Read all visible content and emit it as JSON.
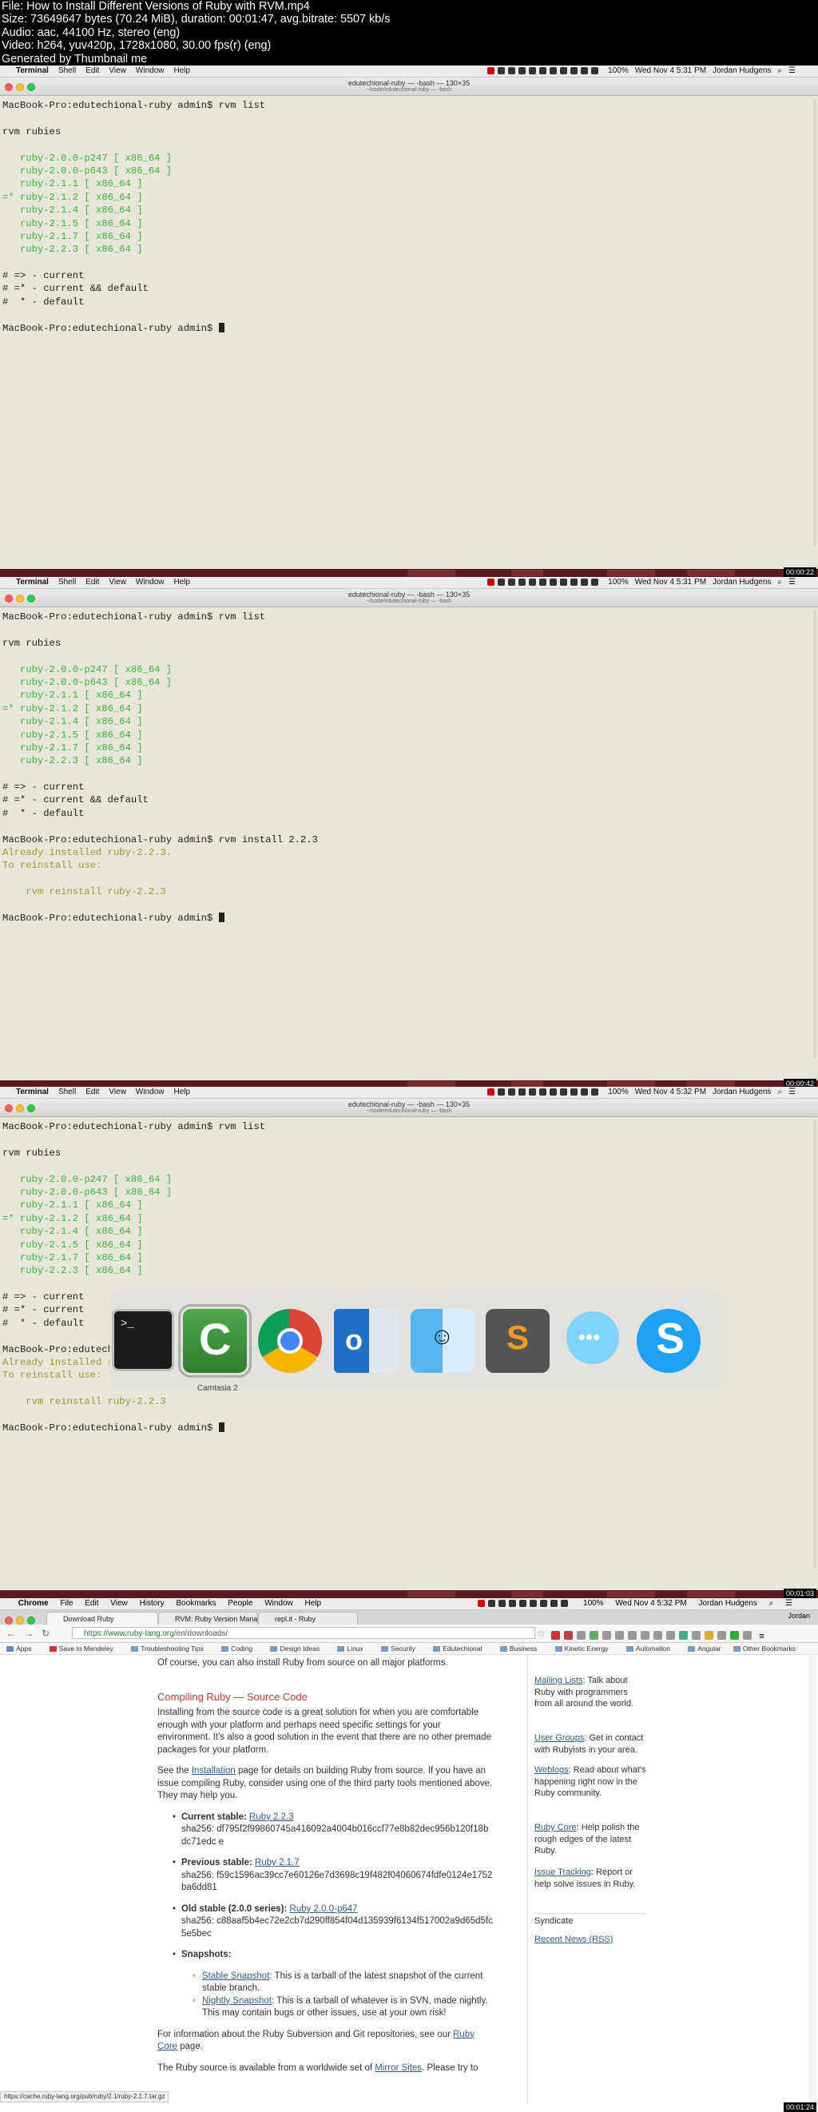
{
  "header": {
    "line1": "File: How to Install Different Versions of Ruby with RVM.mp4",
    "line2": "Size: 73649647 bytes (70.24 MiB), duration: 00:01:47, avg.bitrate: 5507 kb/s",
    "line3": "Audio: aac, 44100 Hz, stereo (eng)",
    "line4": "Video: h264, yuv420p, 1728x1080, 30.00 fps(r) (eng)",
    "line5": "Generated by Thumbnail me"
  },
  "terminal_menu": {
    "apple": "",
    "app": "Terminal",
    "items": [
      "Shell",
      "Edit",
      "View",
      "Window",
      "Help"
    ],
    "battery": "100%"
  },
  "frames": [
    {
      "clock": "Wed Nov 4  5:31 PM",
      "user": "Jordan Hudgens",
      "window_title": "edutechional-ruby — -bash — 130×35",
      "window_subtitle": "~/code/edutechional-ruby — -bash",
      "timecode": "00:00:22",
      "lines": [
        {
          "text": "MacBook-Pro:edutechional-ruby admin$ rvm list",
          "c": ""
        },
        {
          "text": "",
          "c": ""
        },
        {
          "text": "rvm rubies",
          "c": ""
        },
        {
          "text": "",
          "c": ""
        },
        {
          "text": "   ruby-2.0.0-p247 [ x86_64 ]",
          "c": "g"
        },
        {
          "text": "   ruby-2.0.0-p643 [ x86_64 ]",
          "c": "g"
        },
        {
          "text": "   ruby-2.1.1 [ x86_64 ]",
          "c": "g"
        },
        {
          "text": "=* ruby-2.1.2 [ x86_64 ]",
          "c": "g"
        },
        {
          "text": "   ruby-2.1.4 [ x86_64 ]",
          "c": "g"
        },
        {
          "text": "   ruby-2.1.5 [ x86_64 ]",
          "c": "g"
        },
        {
          "text": "   ruby-2.1.7 [ x86_64 ]",
          "c": "g"
        },
        {
          "text": "   ruby-2.2.3 [ x86_64 ]",
          "c": "g"
        },
        {
          "text": "",
          "c": ""
        },
        {
          "text": "# => - current",
          "c": ""
        },
        {
          "text": "# =* - current && default",
          "c": ""
        },
        {
          "text": "#  * - default",
          "c": ""
        },
        {
          "text": "",
          "c": ""
        },
        {
          "text": "MacBook-Pro:edutechional-ruby admin$ ",
          "c": "",
          "cursor": true
        }
      ]
    },
    {
      "clock": "Wed Nov 4  5:31 PM",
      "user": "Jordan Hudgens",
      "window_title": "edutechional-ruby — -bash — 130×35",
      "window_subtitle": "~/code/edutechional-ruby — -bash",
      "timecode": "00:00:42",
      "lines": [
        {
          "text": "MacBook-Pro:edutechional-ruby admin$ rvm list",
          "c": ""
        },
        {
          "text": "",
          "c": ""
        },
        {
          "text": "rvm rubies",
          "c": ""
        },
        {
          "text": "",
          "c": ""
        },
        {
          "text": "   ruby-2.0.0-p247 [ x86_64 ]",
          "c": "g"
        },
        {
          "text": "   ruby-2.0.0-p643 [ x86_64 ]",
          "c": "g"
        },
        {
          "text": "   ruby-2.1.1 [ x86_64 ]",
          "c": "g"
        },
        {
          "text": "=* ruby-2.1.2 [ x86_64 ]",
          "c": "g"
        },
        {
          "text": "   ruby-2.1.4 [ x86_64 ]",
          "c": "g"
        },
        {
          "text": "   ruby-2.1.5 [ x86_64 ]",
          "c": "g"
        },
        {
          "text": "   ruby-2.1.7 [ x86_64 ]",
          "c": "g"
        },
        {
          "text": "   ruby-2.2.3 [ x86_64 ]",
          "c": "g"
        },
        {
          "text": "",
          "c": ""
        },
        {
          "text": "# => - current",
          "c": ""
        },
        {
          "text": "# =* - current && default",
          "c": ""
        },
        {
          "text": "#  * - default",
          "c": ""
        },
        {
          "text": "",
          "c": ""
        },
        {
          "text": "MacBook-Pro:edutechional-ruby admin$ rvm install 2.2.3",
          "c": ""
        },
        {
          "text": "Already installed ruby-2.2.3.",
          "c": "o"
        },
        {
          "text": "To reinstall use:",
          "c": "o"
        },
        {
          "text": "",
          "c": ""
        },
        {
          "text": "    rvm reinstall ruby-2.2.3",
          "c": "o"
        },
        {
          "text": "",
          "c": ""
        },
        {
          "text": "MacBook-Pro:edutechional-ruby admin$ ",
          "c": "",
          "cursor": true
        }
      ]
    },
    {
      "clock": "Wed Nov 4  5:32 PM",
      "user": "Jordan Hudgens",
      "window_title": "edutechional-ruby — -bash — 130×35",
      "window_subtitle": "~/code/edutechional-ruby — -bash",
      "timecode": "00:01:03",
      "lines": [
        {
          "text": "MacBook-Pro:edutechional-ruby admin$ rvm list",
          "c": ""
        },
        {
          "text": "",
          "c": ""
        },
        {
          "text": "rvm rubies",
          "c": ""
        },
        {
          "text": "",
          "c": ""
        },
        {
          "text": "   ruby-2.0.0-p247 [ x86_64 ]",
          "c": "g"
        },
        {
          "text": "   ruby-2.0.0-p643 [ x86_64 ]",
          "c": "g"
        },
        {
          "text": "   ruby-2.1.1 [ x86_64 ]",
          "c": "g"
        },
        {
          "text": "=* ruby-2.1.2 [ x86_64 ]",
          "c": "g"
        },
        {
          "text": "   ruby-2.1.4 [ x86_64 ]",
          "c": "g"
        },
        {
          "text": "   ruby-2.1.5 [ x86_64 ]",
          "c": "g"
        },
        {
          "text": "   ruby-2.1.7 [ x86_64 ]",
          "c": "g"
        },
        {
          "text": "   ruby-2.2.3 [ x86_64 ]",
          "c": "g"
        },
        {
          "text": "",
          "c": ""
        },
        {
          "text": "# => - current",
          "c": ""
        },
        {
          "text": "# =* - current",
          "c": ""
        },
        {
          "text": "#  * - default",
          "c": ""
        },
        {
          "text": "",
          "c": ""
        },
        {
          "text": "MacBook-Pro:edutechional-ruby admin$ rvm install 2.2.3",
          "c": ""
        },
        {
          "text": "Already installed ruby-2.2.3.",
          "c": "o"
        },
        {
          "text": "To reinstall use:",
          "c": "o"
        },
        {
          "text": "",
          "c": ""
        },
        {
          "text": "    rvm reinstall ruby-2.2.3",
          "c": "o"
        },
        {
          "text": "",
          "c": ""
        },
        {
          "text": "MacBook-Pro:edutechional-ruby admin$ ",
          "c": "",
          "cursor": true
        }
      ]
    }
  ],
  "app_switcher": {
    "apps": [
      "terminal-icon",
      "camtasia-icon",
      "chrome-icon",
      "outlook-icon",
      "finder-icon",
      "sublime-icon",
      "messages-icon",
      "skype-icon"
    ],
    "selected_label": "Camtasia 2"
  },
  "browser": {
    "menu": {
      "app": "Chrome",
      "items": [
        "File",
        "Edit",
        "View",
        "History",
        "Bookmarks",
        "People",
        "Window",
        "Help"
      ],
      "clock": "Wed Nov 4  5:32 PM",
      "user": "Jordan Hudgens",
      "profile": "Jordan"
    },
    "tabs": [
      "Download Ruby",
      "RVM: Ruby Version Manag",
      "repl.it - Ruby"
    ],
    "url_host": "https://www.ruby-lang.org",
    "url_path": "/en/downloads/",
    "bookmarks": [
      "Apps",
      "Save to Mendeley",
      "Troubleshooting Tips",
      "Coding",
      "Design Ideas",
      "Linux",
      "Security",
      "Edutechional",
      "Business",
      "Kinetic Energy",
      "Automation",
      "Angular"
    ],
    "other_bookmarks": "Other Bookmarks",
    "content": {
      "intro": "Of course, you can also install Ruby from source on all major platforms.",
      "heading": "Compiling Ruby — Source Code",
      "p1": "Installing from the source code is a great solution for when you are comfortable enough with your platform and perhaps need specific settings for your environment. It’s also a good solution in the event that there are no other premade packages for your platform.",
      "p2_a": "See the ",
      "p2_link": "Installation",
      "p2_b": " page for details on building Ruby from source. If you have an issue compiling Ruby, consider using one of the third party tools mentioned above. They may help you.",
      "current_label": "Current stable:",
      "current_link": "Ruby 2.2.3",
      "current_sha": "sha256: df795f2f99860745a416092a4004b016ccf77e8b82dec956b120f18bdc71edc e",
      "previous_label": "Previous stable:",
      "previous_link": "Ruby 2.1.7",
      "previous_sha": "sha256: f59c1596ac39cc7e60126e7d3698c19f482f04060674fdfe0124e1752ba6dd81",
      "old_label": "Old stable (2.0.0 series):",
      "old_link": "Ruby 2.0.0-p647",
      "old_sha": "sha256: c88aaf5b4ec72e2cb7d290ff854f04d135939f6134f517002a9d65d5fc5e5bec",
      "snapshots_label": "Snapshots:",
      "stable_snap_link": "Stable Snapshot",
      "stable_snap_text": ": This is a tarball of the latest snapshot of the current stable branch.",
      "nightly_snap_link": "Nightly Snapshot",
      "nightly_snap_text": ": This is a tarball of whatever is in SVN, made nightly. This may contain bugs or other issues, use at your own risk!",
      "svn_a": "For information about the Ruby Subversion and Git repositories, see our ",
      "svn_link": "Ruby Core",
      "svn_b": " page.",
      "mirror_a": "The Ruby source is available from a worldwide set of ",
      "mirror_link": "Mirror Sites",
      "mirror_b": ". Please try to"
    },
    "sidebar": {
      "mailing_link": "Mailing Lists",
      "mailing_text": ": Talk about Ruby with programmers from all around the world.",
      "groups_link": "User Groups",
      "groups_text": ": Get in contact with Rubyists in your area.",
      "weblogs_link": "Weblogs",
      "weblogs_text": ": Read about what’s happening right now in the Ruby community.",
      "core_link": "Ruby Core",
      "core_text": ": Help polish the rough edges of the latest Ruby.",
      "issue_link": "Issue Tracking",
      "issue_text": ": Report or help solve issues in Ruby.",
      "syndicate": "Syndicate",
      "rss_link": "Recent News (RSS)"
    },
    "status_url": "https://cache.ruby-lang.org/pub/ruby/2.1/ruby-2.1.7.tar.gz",
    "timecode": "00:01:24"
  }
}
